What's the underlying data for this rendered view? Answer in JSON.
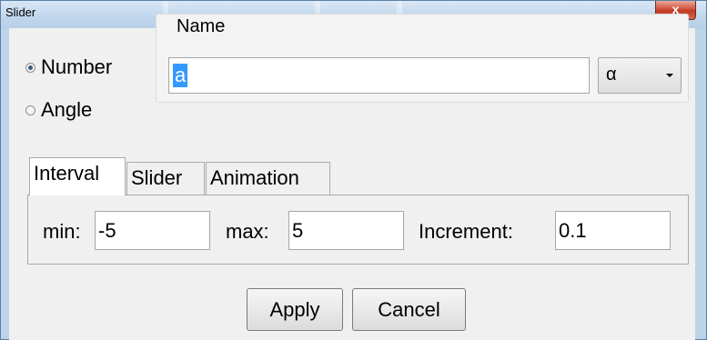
{
  "window": {
    "title": "Slider",
    "close_label": "x"
  },
  "type_options": [
    {
      "label": "Number",
      "checked": true
    },
    {
      "label": "Angle",
      "checked": false
    }
  ],
  "name": {
    "label": "Name",
    "value": "a",
    "greek_selected": "α"
  },
  "tabs": [
    {
      "label": "Interval",
      "active": true
    },
    {
      "label": "Slider",
      "active": false
    },
    {
      "label": "Animation",
      "active": false
    }
  ],
  "interval": {
    "min_label": "min:",
    "min_value": "-5",
    "max_label": "max:",
    "max_value": "5",
    "increment_label": "Increment:",
    "increment_value": "0.1"
  },
  "buttons": {
    "apply": "Apply",
    "cancel": "Cancel"
  }
}
